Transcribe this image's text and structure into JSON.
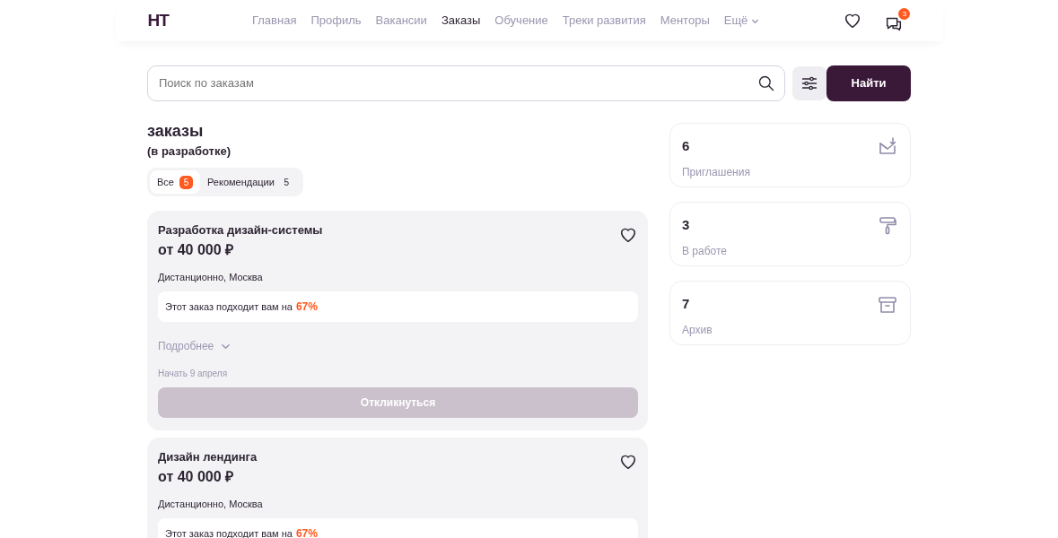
{
  "header": {
    "logo": "HT",
    "nav": [
      {
        "label": "Главная",
        "selected": false
      },
      {
        "label": "Профиль",
        "selected": false
      },
      {
        "label": "Вакансии",
        "selected": false
      },
      {
        "label": "Заказы",
        "selected": true
      },
      {
        "label": "Обучение",
        "selected": false
      },
      {
        "label": "Треки развития",
        "selected": false
      },
      {
        "label": "Менторы",
        "selected": false
      }
    ],
    "more": "Ещё",
    "messages_badge": "3"
  },
  "search": {
    "placeholder": "Поиск по заказам",
    "button": "Найти"
  },
  "title": "заказы",
  "subtitle": "(в разработке)",
  "tabs": [
    {
      "label": "Все",
      "count": "5",
      "selected": true
    },
    {
      "label": "Рекомендации",
      "count": "5",
      "selected": false
    }
  ],
  "orders": [
    {
      "title": "Разработка дизайн-системы",
      "price": "от 40 000 ₽",
      "location": "Дистанционно, Москва",
      "match_text": "Этот заказ подходит вам на",
      "match": "67%",
      "details": "Подробнее",
      "start": "Начать 9 апреля",
      "action": "Откликнуться",
      "disabled": true
    },
    {
      "title": "Дизайн лендинга",
      "price": "от 40 000 ₽",
      "location": "Дистанционно, Москва",
      "match_text": "Этот заказ подходит вам на",
      "match": "67%"
    }
  ],
  "stats": [
    {
      "count": "6",
      "label": "Приглашения",
      "kind": "invite"
    },
    {
      "count": "3",
      "label": "В работе",
      "kind": "work"
    },
    {
      "count": "7",
      "label": "Архив",
      "kind": "archive"
    }
  ]
}
